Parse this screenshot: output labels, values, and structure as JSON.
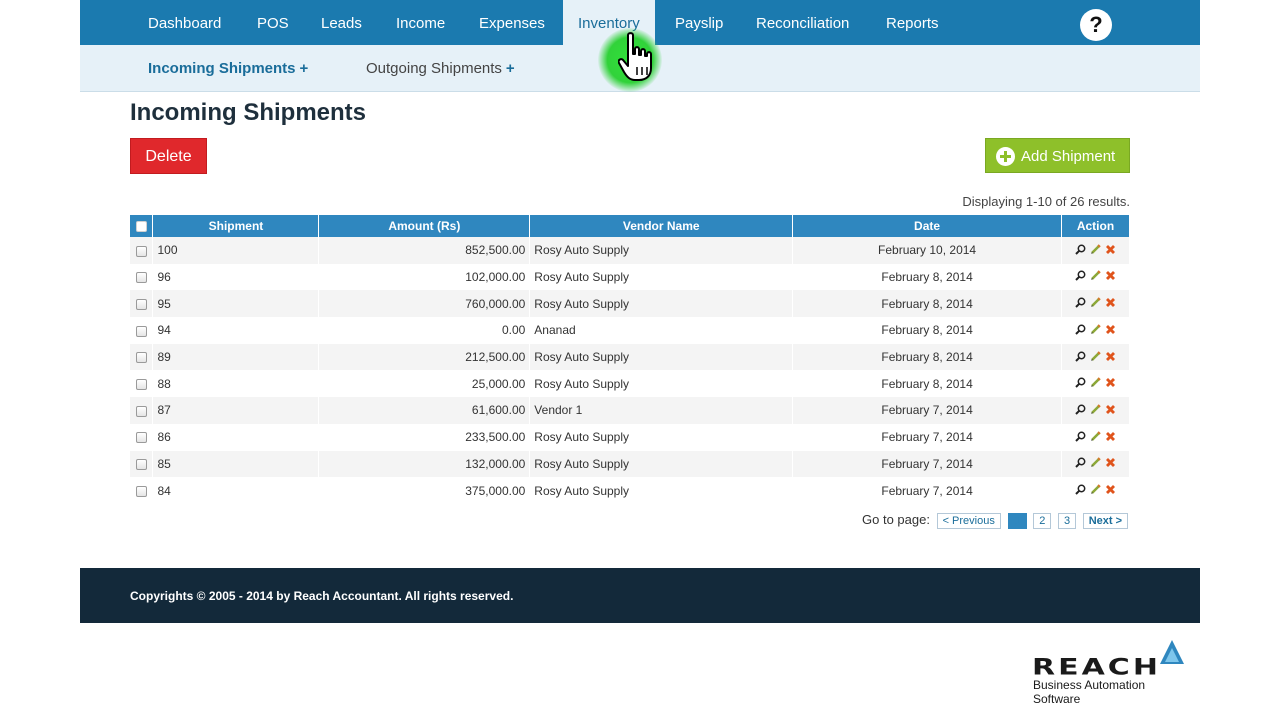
{
  "nav": {
    "items": [
      {
        "label": "Dashboard"
      },
      {
        "label": "POS"
      },
      {
        "label": "Leads"
      },
      {
        "label": "Income"
      },
      {
        "label": "Expenses"
      },
      {
        "label": "Inventory"
      },
      {
        "label": "Payslip"
      },
      {
        "label": "Reconciliation"
      },
      {
        "label": "Reports"
      }
    ],
    "active": "Inventory",
    "help_label": "?"
  },
  "subnav": {
    "items": [
      {
        "label": "Incoming Shipments",
        "plus": "+"
      },
      {
        "label": "Outgoing Shipments",
        "plus": "+"
      }
    ],
    "active": "Incoming Shipments"
  },
  "page": {
    "title": "Incoming Shipments",
    "delete_label": "Delete",
    "add_label": "Add Shipment",
    "summary": "Displaying 1-10 of 26 results."
  },
  "table": {
    "columns": [
      "Shipment",
      "Amount (Rs)",
      "Vendor Name",
      "Date",
      "Action"
    ],
    "rows": [
      {
        "shipment": "100",
        "amount": "852,500.00",
        "vendor": "Rosy Auto Supply",
        "date": "February 10, 2014"
      },
      {
        "shipment": "96",
        "amount": "102,000.00",
        "vendor": "Rosy Auto Supply",
        "date": "February 8, 2014"
      },
      {
        "shipment": "95",
        "amount": "760,000.00",
        "vendor": "Rosy Auto Supply",
        "date": "February 8, 2014"
      },
      {
        "shipment": "94",
        "amount": "0.00",
        "vendor": "Ananad",
        "date": "February 8, 2014"
      },
      {
        "shipment": "89",
        "amount": "212,500.00",
        "vendor": "Rosy Auto Supply",
        "date": "February 8, 2014"
      },
      {
        "shipment": "88",
        "amount": "25,000.00",
        "vendor": "Rosy Auto Supply",
        "date": "February 8, 2014"
      },
      {
        "shipment": "87",
        "amount": "61,600.00",
        "vendor": "Vendor 1",
        "date": "February 7, 2014"
      },
      {
        "shipment": "86",
        "amount": "233,500.00",
        "vendor": "Rosy Auto Supply",
        "date": "February 7, 2014"
      },
      {
        "shipment": "85",
        "amount": "132,000.00",
        "vendor": "Rosy Auto Supply",
        "date": "February 7, 2014"
      },
      {
        "shipment": "84",
        "amount": "375,000.00",
        "vendor": "Rosy Auto Supply",
        "date": "February 7, 2014"
      }
    ],
    "row_actions": [
      "view-icon",
      "edit-icon",
      "delete-icon"
    ]
  },
  "pager": {
    "label": "Go to page:",
    "prev": "< Previous",
    "pages": [
      "1",
      "2",
      "3"
    ],
    "current": "1",
    "next": "Next >"
  },
  "footer": {
    "copyright": "Copyrights © 2005 - 2014 by Reach Accountant. All rights reserved."
  },
  "logo": {
    "word": "REACH",
    "tagline": "Business Automation Software"
  },
  "colors": {
    "nav_bg": "#1b7aaf",
    "subnav_bg": "#e6f1f8",
    "header_bg": "#2f87bf",
    "delete": "#e0282c",
    "add": "#8ec02a",
    "footer_bg": "#13293a",
    "cursor_highlight": "#31d23a"
  }
}
